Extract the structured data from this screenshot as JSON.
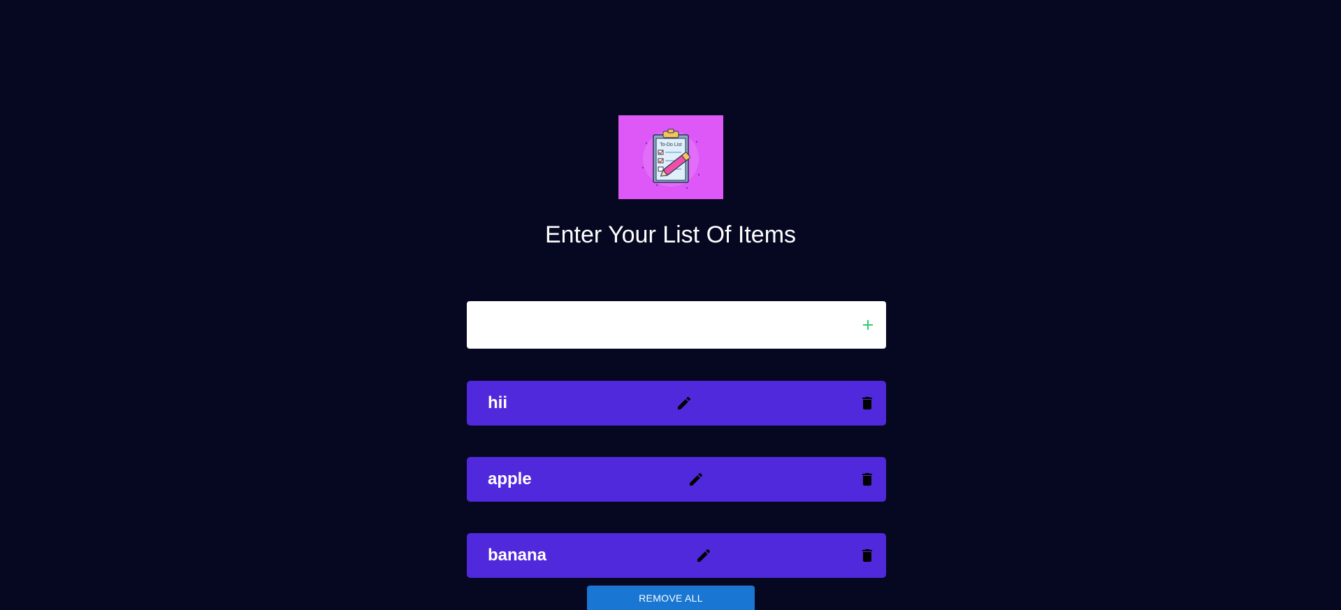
{
  "header": {
    "heading": "Enter Your List Of Items",
    "logo_caption": "To-Do List"
  },
  "input": {
    "value": "",
    "placeholder": ""
  },
  "icons": {
    "add": "plus-icon",
    "edit": "pencil-icon",
    "delete": "trash-icon"
  },
  "items": [
    {
      "label": "hii"
    },
    {
      "label": "apple"
    },
    {
      "label": "banana"
    }
  ],
  "actions": {
    "remove_all_label": "REMOVE ALL"
  },
  "colors": {
    "background": "#060822",
    "item_bg": "#5129dc",
    "accent_add": "#2ecc71",
    "button_bg": "#1976d2",
    "logo_bg": "#dd58f7"
  }
}
